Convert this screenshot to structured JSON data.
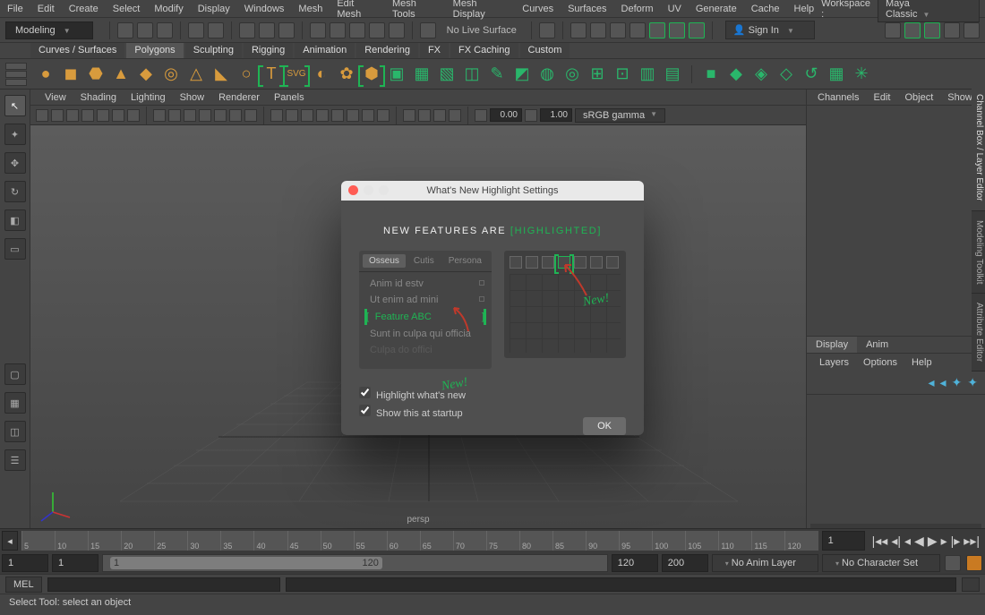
{
  "menubar": [
    "File",
    "Edit",
    "Create",
    "Select",
    "Modify",
    "Display",
    "Windows",
    "Mesh",
    "Edit Mesh",
    "Mesh Tools",
    "Mesh Display",
    "Curves",
    "Surfaces",
    "Deform",
    "UV",
    "Generate",
    "Cache",
    "Help"
  ],
  "workspace": {
    "label": "Workspace :",
    "value": "Maya Classic"
  },
  "mode_dropdown": "Modeling",
  "no_live_surface": "No Live Surface",
  "sign_in": "Sign In",
  "shelf_tabs": [
    "Curves / Surfaces",
    "Polygons",
    "Sculpting",
    "Rigging",
    "Animation",
    "Rendering",
    "FX",
    "FX Caching",
    "Custom"
  ],
  "shelf_active": "Polygons",
  "panel_menus": [
    "View",
    "Shading",
    "Lighting",
    "Show",
    "Renderer",
    "Panels"
  ],
  "panel_numbers": {
    "a": "0.00",
    "b": "1.00"
  },
  "gamma_drop": "sRGB gamma",
  "persp_label": "persp",
  "right_tabs": [
    "Channel Box / Layer Editor",
    "Modeling Toolkit",
    "Attribute Editor"
  ],
  "chan_menus": [
    "Channels",
    "Edit",
    "Object",
    "Show"
  ],
  "layer_tabs": [
    "Display",
    "Anim"
  ],
  "layer_menus": [
    "Layers",
    "Options",
    "Help"
  ],
  "timeline": {
    "start_frame": "1",
    "range_start": "1",
    "range_end": "120",
    "end_frame": "120",
    "total": "200",
    "current": "1",
    "anim_layer": "No Anim Layer",
    "char_set": "No Character Set",
    "ticks": [
      "5",
      "10",
      "15",
      "20",
      "25",
      "30",
      "35",
      "40",
      "45",
      "50",
      "55",
      "60",
      "65",
      "70",
      "75",
      "80",
      "85",
      "90",
      "95",
      "100",
      "105",
      "110",
      "115",
      "120"
    ]
  },
  "cmd": {
    "label": "MEL"
  },
  "status": "Select Tool: select an object",
  "modal": {
    "title": "What's New Highlight Settings",
    "heading_pre": "NEW  FEATURES  ARE ",
    "heading_hl": "HIGHLIGHTED",
    "left_tabs": [
      "Osseus",
      "Cutis",
      "Persona"
    ],
    "list": [
      "Anim id estv",
      "Ut enim ad mini",
      "Feature ABC",
      "Sunt in culpa qui officia",
      "Culpa do offici"
    ],
    "hl_index": 2,
    "new_label": "New!",
    "check1": "Highlight what's new",
    "check2": "Show this at startup",
    "ok": "OK"
  }
}
